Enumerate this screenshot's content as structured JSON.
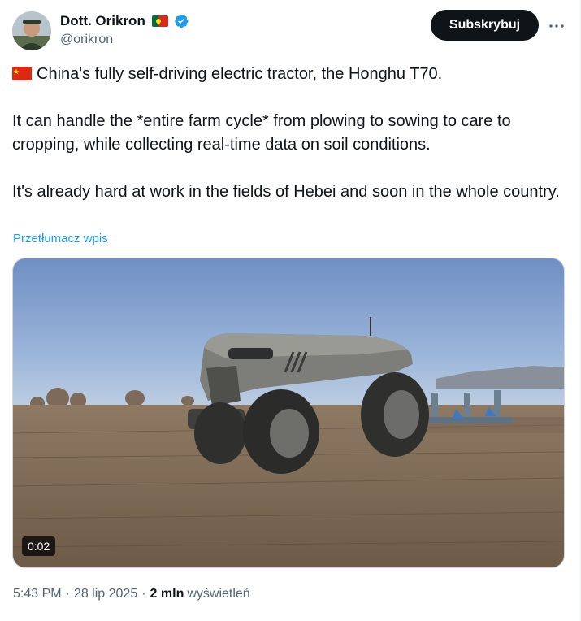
{
  "author": {
    "display_name": "Dott. Orikron",
    "handle": "@orikron",
    "avatar_icon": "profile-photo",
    "name_flag_icon": "flag-portugal-icon",
    "verified_icon": "verified-badge-icon",
    "verified_color": "#1d9bf0"
  },
  "actions": {
    "subscribe_label": "Subskrybuj",
    "more_icon": "ellipsis-icon"
  },
  "tweet": {
    "flag_icon": "flag-china-icon",
    "line1": "China's fully self-driving electric tractor, the Honghu T70.",
    "paragraph2": "It can handle the *entire farm cycle* from plowing to sowing to care to cropping, while collecting real-time data on soil conditions.",
    "paragraph3": "It's already hard at work in the fields of Hebei and soon in the whole country.",
    "translate_label": "Przetłumacz wpis"
  },
  "media": {
    "type": "video",
    "duration": "0:02"
  },
  "meta": {
    "time": "5:43 PM",
    "separator": "·",
    "date": "28 lip 2025",
    "views_count": "2 mln",
    "views_label": "wyświetleń"
  },
  "colors": {
    "text": "#0f1419",
    "secondary": "#536471",
    "link": "#1d9bf0",
    "button": "#0f1419"
  }
}
